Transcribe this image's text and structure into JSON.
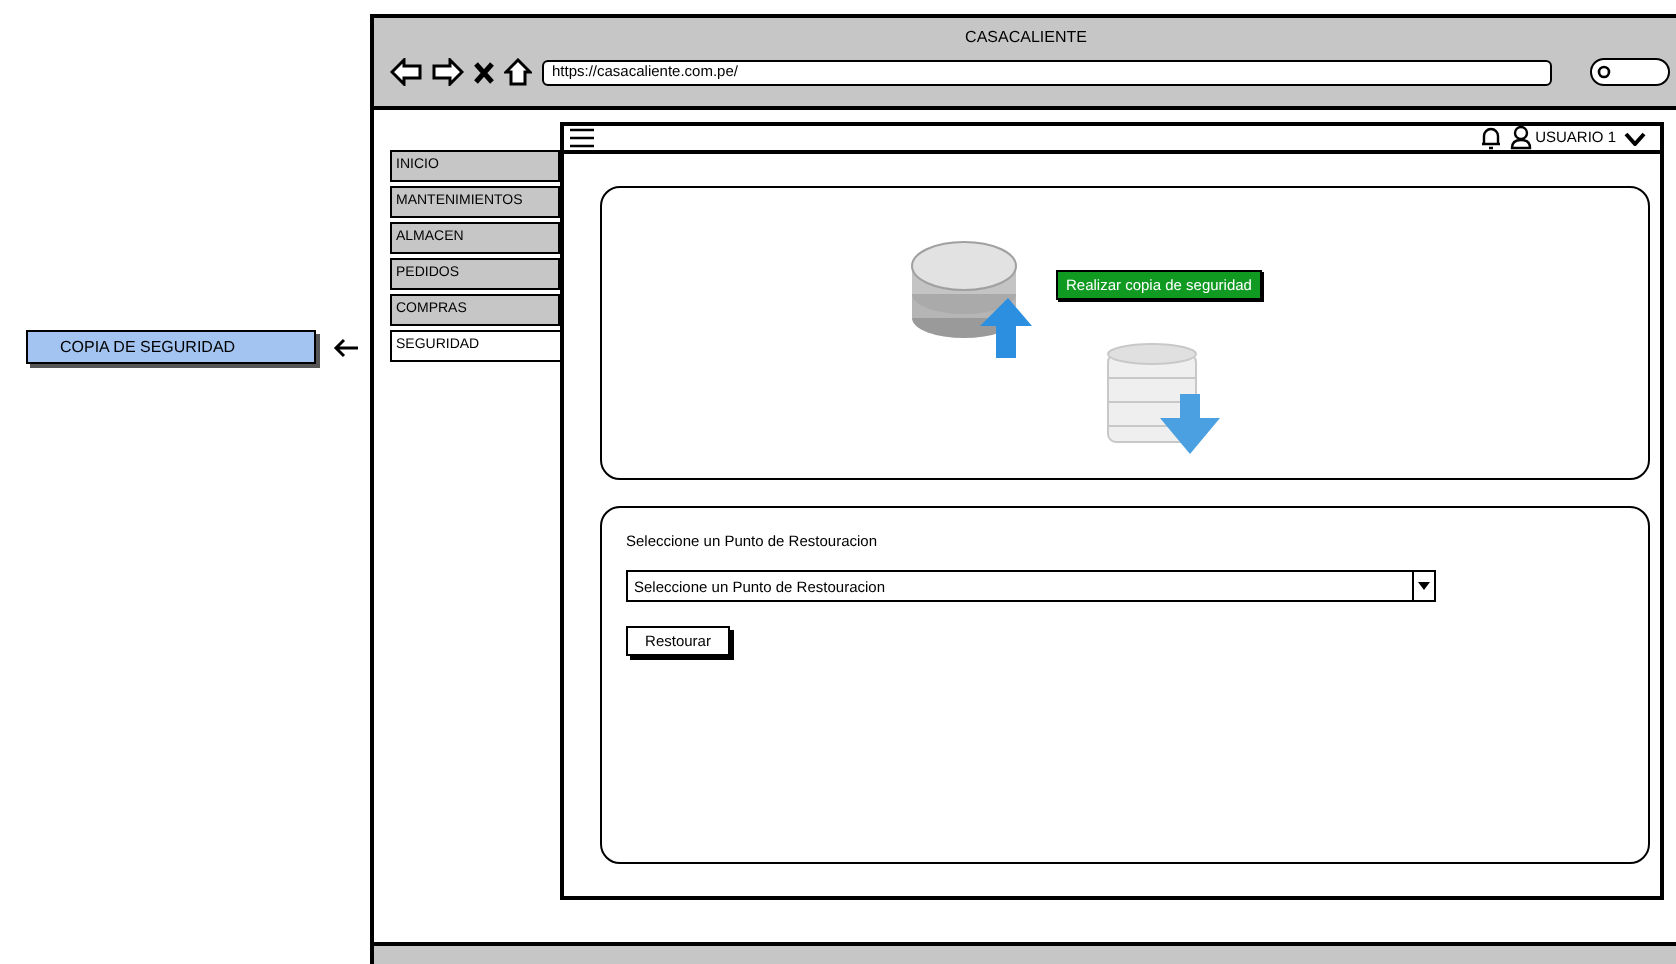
{
  "browser": {
    "title": "CASACALIENTE",
    "url": "https://casacaliente.com.pe/"
  },
  "submenu": {
    "items": [
      {
        "label": "COPIA DE SEGURIDAD",
        "selected": true
      }
    ]
  },
  "nav_tabs": [
    {
      "label": "INICIO",
      "selected": false
    },
    {
      "label": "MANTENIMIENTOS",
      "selected": false
    },
    {
      "label": "ALMACEN",
      "selected": false
    },
    {
      "label": "PEDIDOS",
      "selected": false
    },
    {
      "label": "COMPRAS",
      "selected": false
    },
    {
      "label": "SEGURIDAD",
      "selected": true
    }
  ],
  "header": {
    "user": "USUARIO 1"
  },
  "backup_card": {
    "button": "Realizar copia de seguridad"
  },
  "restore_card": {
    "label": "Seleccione un Punto de Restouracion",
    "select": {
      "value": "Seleccione un Punto de Restouracion"
    },
    "button": "Restourar"
  }
}
